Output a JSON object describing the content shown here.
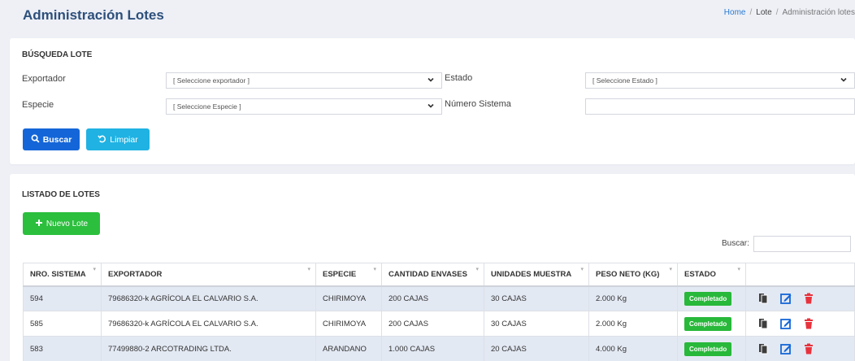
{
  "header": {
    "title": "Administración Lotes",
    "breadcrumb": {
      "home": "Home",
      "sep": "/",
      "section": "Lote",
      "current": "Administración lotes"
    }
  },
  "search": {
    "title": "BÚSQUEDA LOTE",
    "exportador": {
      "label": "Exportador",
      "value": "[ Seleccione exportador ]"
    },
    "estado": {
      "label": "Estado",
      "value": "[ Seleccione Estado ]"
    },
    "especie": {
      "label": "Especie",
      "value": "[ Seleccione Especie ]"
    },
    "numero_sistema": {
      "label": "Número Sistema",
      "value": ""
    },
    "buscar_label": "Buscar",
    "limpiar_label": "Limpiar"
  },
  "listado": {
    "title": "LISTADO DE LOTES",
    "nuevo_label": "Nuevo Lote",
    "buscar_label": "Buscar:",
    "columns": [
      "NRO. SISTEMA",
      "EXPORTADOR",
      "ESPECIE",
      "CANTIDAD ENVASES",
      "UNIDADES MUESTRA",
      "PESO NETO (KG)",
      "ESTADO",
      ""
    ],
    "rows": [
      {
        "nro": "594",
        "exportador": "79686320-k AGRÍCOLA EL CALVARIO S.A.",
        "especie": "CHIRIMOYA",
        "envases": "200 CAJAS",
        "muestra": "30 CAJAS",
        "peso": "2.000 Kg",
        "estado": "Completado"
      },
      {
        "nro": "585",
        "exportador": "79686320-k AGRÍCOLA EL CALVARIO S.A.",
        "especie": "CHIRIMOYA",
        "envases": "200 CAJAS",
        "muestra": "30 CAJAS",
        "peso": "2.000 Kg",
        "estado": "Completado"
      },
      {
        "nro": "583",
        "exportador": "77499880-2 ARCOTRADING LTDA.",
        "especie": "ARANDANO",
        "envases": "1.000 CAJAS",
        "muestra": "20 CAJAS",
        "peso": "4.000 Kg",
        "estado": "Completado"
      }
    ]
  },
  "colors": {
    "primary": "#1466d8",
    "info": "#1fb2e3",
    "success": "#2bbf3d",
    "danger": "#e8323c",
    "title": "#2d4f7b"
  },
  "icons": {
    "search": "search-icon",
    "undo": "undo-icon",
    "plus": "plus-icon",
    "copy": "copy-icon",
    "edit": "edit-icon",
    "delete": "trash-icon"
  }
}
